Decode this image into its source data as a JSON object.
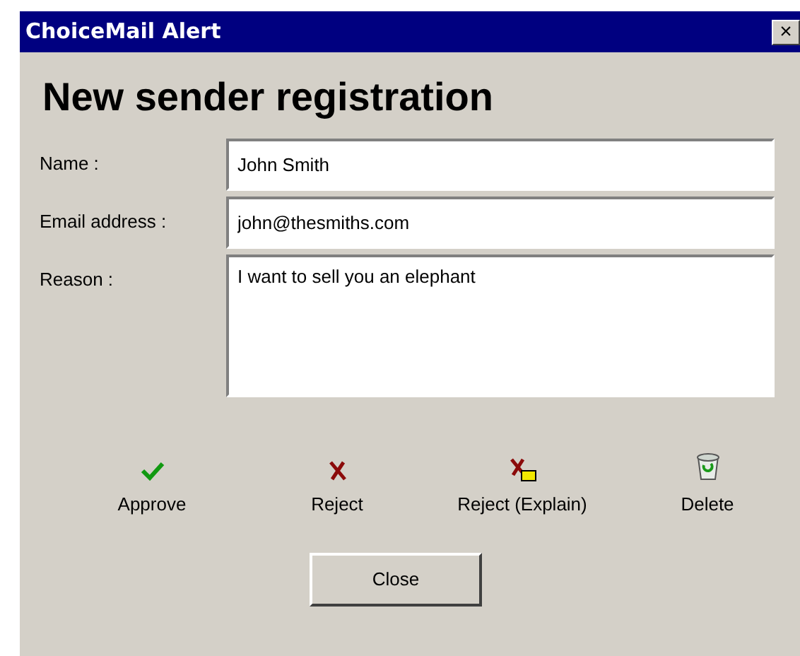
{
  "window": {
    "title": "ChoiceMail Alert",
    "close": "×"
  },
  "heading": "New sender registration",
  "fields": [
    {
      "label": "Name :",
      "value": "John Smith",
      "kind": "line"
    },
    {
      "label": "Email address :",
      "value": "john@thesmiths.com",
      "kind": "line"
    },
    {
      "label": "Reason :",
      "value": "I want to sell you an elephant",
      "kind": "area"
    }
  ],
  "actions": [
    {
      "label": "Approve",
      "kind": "approve"
    },
    {
      "label": "Reject",
      "kind": "reject"
    },
    {
      "label": "Reject (Explain)",
      "kind": "reject_explain"
    },
    {
      "label": "Delete",
      "kind": "delete"
    }
  ],
  "close_button": "Close"
}
